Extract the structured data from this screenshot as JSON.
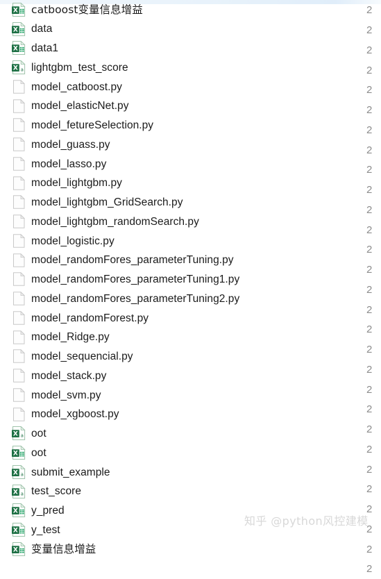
{
  "window": {
    "background_color": "#ffffff",
    "text_color": "#1b1b1b",
    "accent_color": "#1d7044",
    "top_band_color": "#e4f0fa"
  },
  "colors": {
    "excel_green": "#1d7044",
    "excel_green_light": "#21a366",
    "doc_outline": "#c8c8c8",
    "date_text": "#8d8d8d",
    "watermark": "#d8d8d8"
  },
  "date_column": {
    "truncated_value": "2",
    "rows": 28
  },
  "watermark": {
    "text": "知乎 @python风控建模"
  },
  "files": [
    {
      "name": "catboost变量信息增益",
      "icon": "excel-xlsx-icon",
      "type": "xlsx",
      "cjk": true,
      "date": "2"
    },
    {
      "name": "data",
      "icon": "excel-xlsx-icon",
      "type": "xlsx",
      "cjk": false,
      "date": "2"
    },
    {
      "name": "data1",
      "icon": "excel-xlsx-icon",
      "type": "xlsx",
      "cjk": false,
      "date": "2"
    },
    {
      "name": "lightgbm_test_score",
      "icon": "excel-csv-icon",
      "type": "csv",
      "cjk": false,
      "date": "2"
    },
    {
      "name": "model_catboost.py",
      "icon": "blank-document-icon",
      "type": "py",
      "cjk": false,
      "date": "2"
    },
    {
      "name": "model_elasticNet.py",
      "icon": "blank-document-icon",
      "type": "py",
      "cjk": false,
      "date": "2"
    },
    {
      "name": "model_fetureSelection.py",
      "icon": "blank-document-icon",
      "type": "py",
      "cjk": false,
      "date": "2"
    },
    {
      "name": "model_guass.py",
      "icon": "blank-document-icon",
      "type": "py",
      "cjk": false,
      "date": "2"
    },
    {
      "name": "model_lasso.py",
      "icon": "blank-document-icon",
      "type": "py",
      "cjk": false,
      "date": "2"
    },
    {
      "name": "model_lightgbm.py",
      "icon": "blank-document-icon",
      "type": "py",
      "cjk": false,
      "date": "2"
    },
    {
      "name": "model_lightgbm_GridSearch.py",
      "icon": "blank-document-icon",
      "type": "py",
      "cjk": false,
      "date": "2"
    },
    {
      "name": "model_lightgbm_randomSearch.py",
      "icon": "blank-document-icon",
      "type": "py",
      "cjk": false,
      "date": "2"
    },
    {
      "name": "model_logistic.py",
      "icon": "blank-document-icon",
      "type": "py",
      "cjk": false,
      "date": "2"
    },
    {
      "name": "model_randomFores_parameterTuning.py",
      "icon": "blank-document-icon",
      "type": "py",
      "cjk": false,
      "date": "2"
    },
    {
      "name": "model_randomFores_parameterTuning1.py",
      "icon": "blank-document-icon",
      "type": "py",
      "cjk": false,
      "date": "2"
    },
    {
      "name": "model_randomFores_parameterTuning2.py",
      "icon": "blank-document-icon",
      "type": "py",
      "cjk": false,
      "date": "2"
    },
    {
      "name": "model_randomForest.py",
      "icon": "blank-document-icon",
      "type": "py",
      "cjk": false,
      "date": "2"
    },
    {
      "name": "model_Ridge.py",
      "icon": "blank-document-icon",
      "type": "py",
      "cjk": false,
      "date": "2"
    },
    {
      "name": "model_sequencial.py",
      "icon": "blank-document-icon",
      "type": "py",
      "cjk": false,
      "date": "2"
    },
    {
      "name": "model_stack.py",
      "icon": "blank-document-icon",
      "type": "py",
      "cjk": false,
      "date": "2"
    },
    {
      "name": "model_svm.py",
      "icon": "blank-document-icon",
      "type": "py",
      "cjk": false,
      "date": "2"
    },
    {
      "name": "model_xgboost.py",
      "icon": "blank-document-icon",
      "type": "py",
      "cjk": false,
      "date": "2"
    },
    {
      "name": "oot",
      "icon": "excel-csv-icon",
      "type": "csv",
      "cjk": false,
      "date": "2"
    },
    {
      "name": "oot",
      "icon": "excel-xlsx-icon",
      "type": "xlsx",
      "cjk": false,
      "date": "2"
    },
    {
      "name": "submit_example",
      "icon": "excel-csv-icon",
      "type": "csv",
      "cjk": false,
      "date": "2"
    },
    {
      "name": "test_score",
      "icon": "excel-csv-icon",
      "type": "csv",
      "cjk": false,
      "date": "2"
    },
    {
      "name": "y_pred",
      "icon": "excel-xlsx-icon",
      "type": "xlsx",
      "cjk": false,
      "date": "2"
    },
    {
      "name": "y_test",
      "icon": "excel-xlsx-icon",
      "type": "xlsx",
      "cjk": false,
      "date": "2"
    },
    {
      "name": "变量信息增益",
      "icon": "excel-xlsx-icon",
      "type": "xlsx",
      "cjk": true,
      "date": "2"
    }
  ]
}
